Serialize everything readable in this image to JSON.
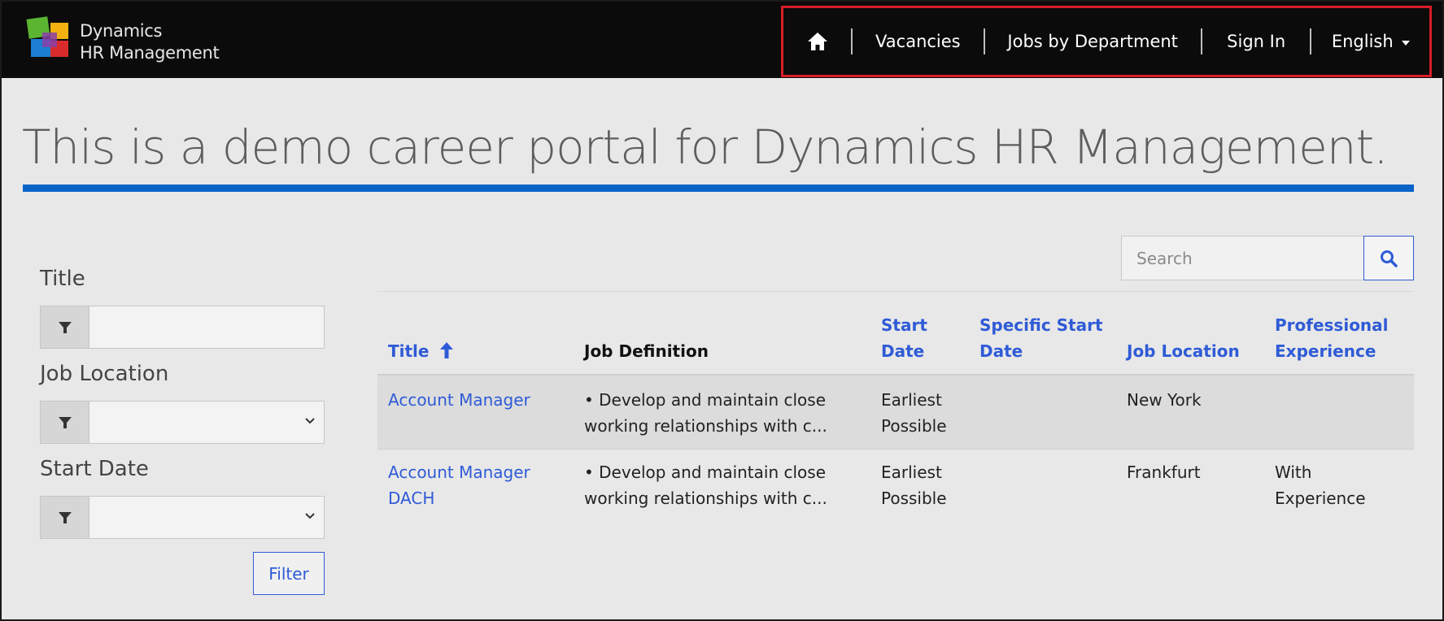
{
  "brand": {
    "line1": "Dynamics",
    "line2": "HR Management",
    "colors": [
      "#5bb531",
      "#f2b111",
      "#1c7fd1",
      "#d92b2b"
    ]
  },
  "nav": {
    "home_icon": "home-icon",
    "items": [
      "Vacancies",
      "Jobs by Department",
      "Sign In"
    ],
    "language": "English",
    "highlight_color": "#d81d27"
  },
  "headline": "This is a demo career portal for Dynamics HR Management.",
  "accent_color": "#0a64c8",
  "filters": {
    "title_label": "Title",
    "location_label": "Job Location",
    "start_label": "Start Date",
    "button": "Filter"
  },
  "search": {
    "placeholder": "Search"
  },
  "table": {
    "headers": {
      "title": "Title",
      "job_definition": "Job Definition",
      "start_date_1": "Start",
      "start_date_2": "Date",
      "specific_1": "Specific Start",
      "specific_2": "Date",
      "location": "Job Location",
      "experience_1": "Professional",
      "experience_2": "Experience"
    },
    "rows": [
      {
        "title_1": "Account Manager",
        "title_2": "",
        "definition_1": "• Develop and maintain close",
        "definition_2": "working relationships with c...",
        "start_1": "Earliest",
        "start_2": "Possible",
        "specific": "",
        "location": "New York",
        "experience_1": "",
        "experience_2": ""
      },
      {
        "title_1": "Account Manager",
        "title_2": "DACH",
        "definition_1": "• Develop and maintain close",
        "definition_2": "working relationships with c...",
        "start_1": "Earliest",
        "start_2": "Possible",
        "specific": "",
        "location": "Frankfurt",
        "experience_1": "With",
        "experience_2": "Experience"
      }
    ]
  }
}
